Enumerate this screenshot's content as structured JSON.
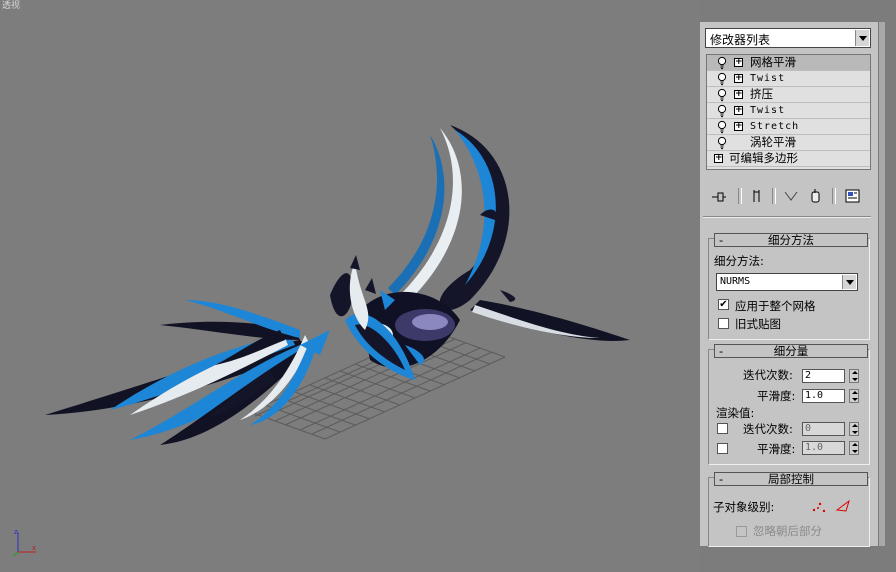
{
  "viewport": {
    "label": "透视"
  },
  "panel": {
    "modifier_list": "修改器列表",
    "stack": [
      {
        "label": "网格平滑",
        "bulb": true,
        "plus": true,
        "selected": true,
        "mono": false
      },
      {
        "label": "Twist",
        "bulb": true,
        "plus": true,
        "selected": false,
        "mono": true
      },
      {
        "label": "挤压",
        "bulb": true,
        "plus": true,
        "selected": false,
        "mono": false
      },
      {
        "label": "Twist",
        "bulb": true,
        "plus": true,
        "selected": false,
        "mono": true
      },
      {
        "label": "Stretch",
        "bulb": true,
        "plus": true,
        "selected": false,
        "mono": true
      },
      {
        "label": "涡轮平滑",
        "bulb": true,
        "plus": false,
        "selected": false,
        "mono": false
      },
      {
        "label": "可编辑多边形",
        "bulb": false,
        "plus": true,
        "selected": false,
        "mono": false
      }
    ],
    "toolbar_icons": [
      "pin-stack-icon",
      "show-end-result-icon",
      "make-unique-icon",
      "remove-modifier-icon",
      "configure-sets-icon"
    ],
    "subdivision_method": {
      "title": "细分方法",
      "minus": "-",
      "method_label": "细分方法:",
      "method_value": "NURMS",
      "apply_whole_mesh": {
        "label": "应用于整个网格",
        "checked": true,
        "mark": "✔"
      },
      "old_style_mapping": {
        "label": "旧式贴图",
        "checked": false
      }
    },
    "subdivision_amount": {
      "title": "细分量",
      "minus": "-",
      "iterations_label": "迭代次数:",
      "iterations_value": "2",
      "smoothness_label": "平滑度:",
      "smoothness_value": "1.0",
      "render_values_label": "渲染值:",
      "render_iterations_label": "迭代次数:",
      "render_iterations_value": "0",
      "render_smoothness_label": "平滑度:",
      "render_smoothness_value": "1.0"
    },
    "local_control": {
      "title": "局部控制",
      "minus": "-",
      "subobject_label": "子对象级别:",
      "ignore_backfacing_label": "忽略朝后部分"
    }
  },
  "colors": {
    "viewport_bg": "#7d7d7d",
    "panel_bg": "#c4c4c4",
    "model_blue": "#1e86d6",
    "model_dark": "#15152a"
  }
}
